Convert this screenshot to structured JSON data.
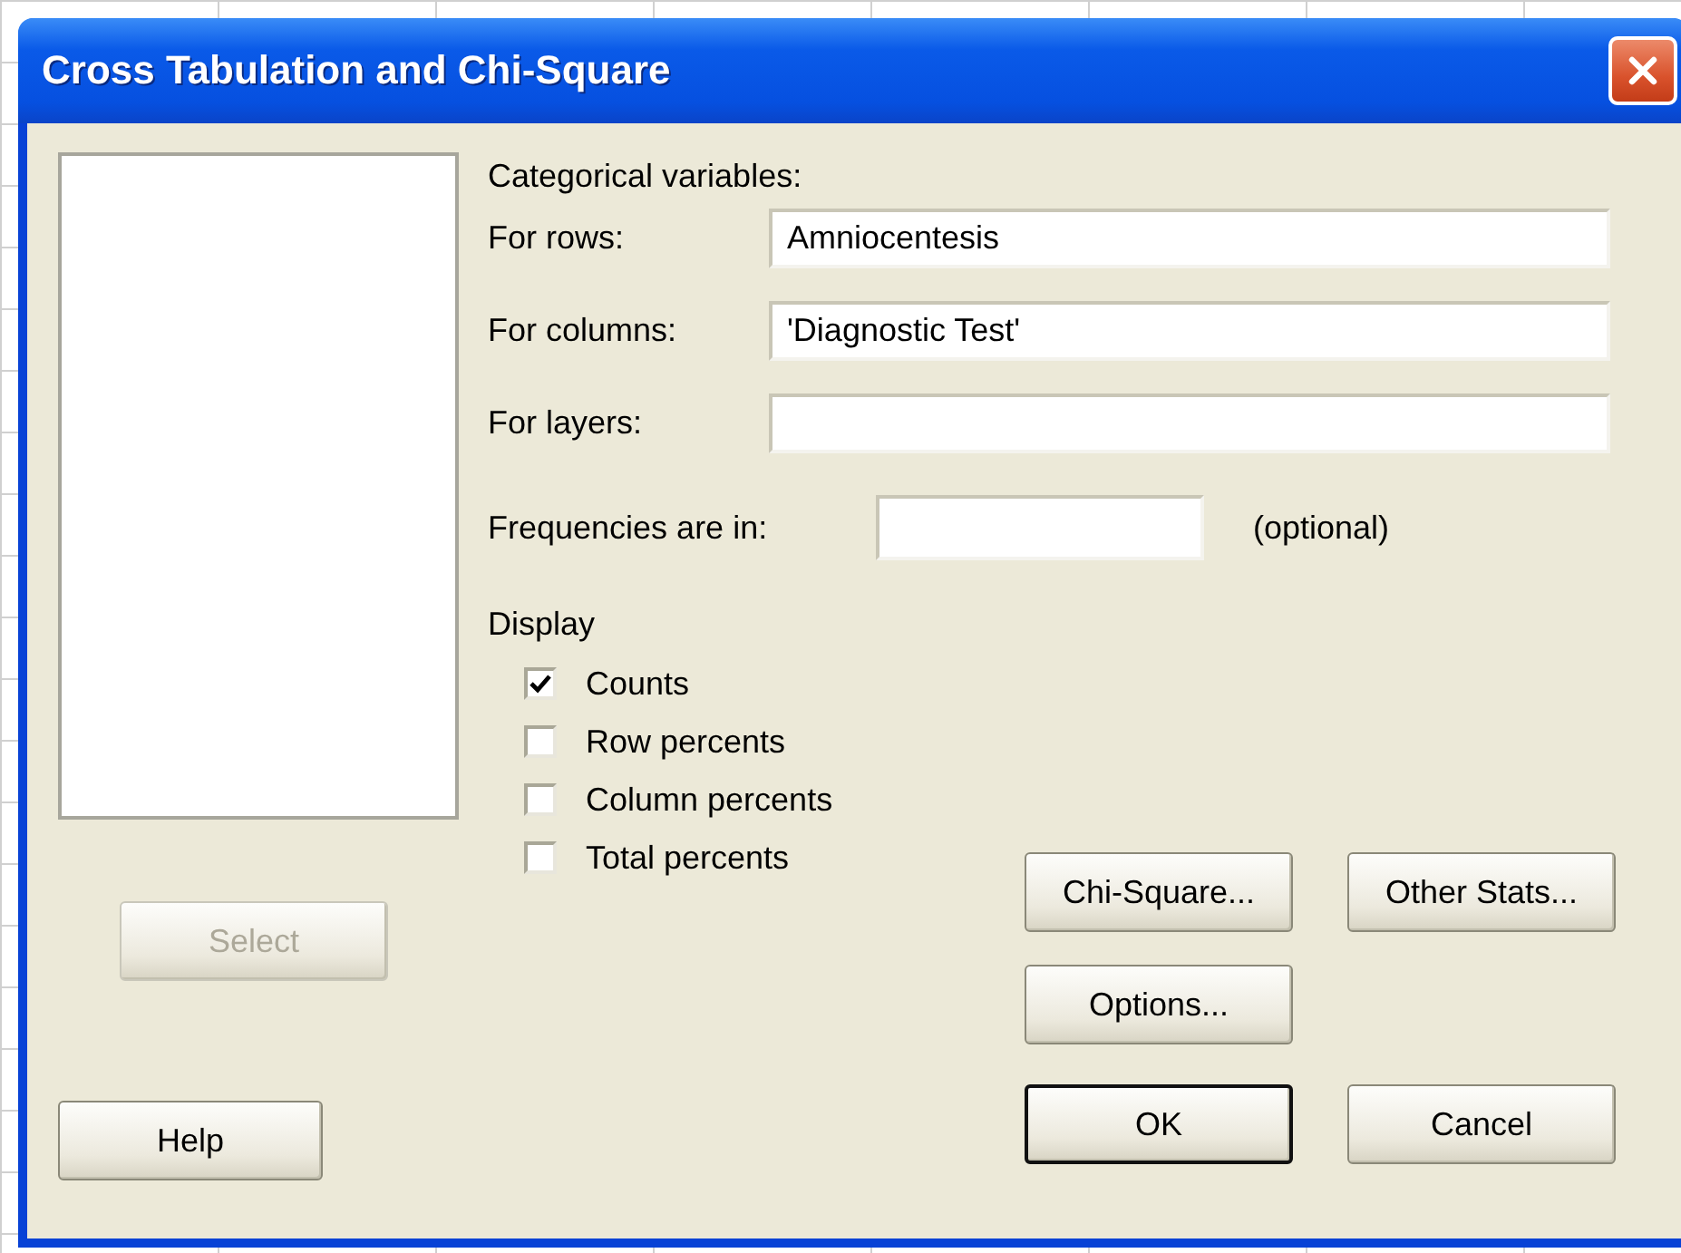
{
  "window": {
    "title": "Cross Tabulation and Chi-Square"
  },
  "variable_list": {
    "select_button": {
      "label": "Select",
      "disabled": true
    },
    "help_button": {
      "label": "Help"
    }
  },
  "categorical_variables": {
    "heading": "Categorical variables:",
    "fields": [
      {
        "label": "For rows:",
        "value": "Amniocentesis"
      },
      {
        "label": "For columns:",
        "value": "'Diagnostic Test'"
      },
      {
        "label": "For layers:"
      }
    ]
  },
  "frequencies": {
    "label": "Frequencies are in:",
    "note": "(optional)"
  },
  "display": {
    "heading": "Display",
    "options": [
      {
        "label": "Counts",
        "checked": true
      },
      {
        "label": "Row percents",
        "checked": false
      },
      {
        "label": "Column percents",
        "checked": false
      },
      {
        "label": "Total percents",
        "checked": false
      }
    ]
  },
  "option_buttons": [
    "Chi-Square...",
    "Other Stats...",
    "Options..."
  ],
  "dialog_buttons": [
    {
      "label": "OK",
      "default": true
    },
    {
      "label": "Cancel",
      "default": false
    }
  ]
}
